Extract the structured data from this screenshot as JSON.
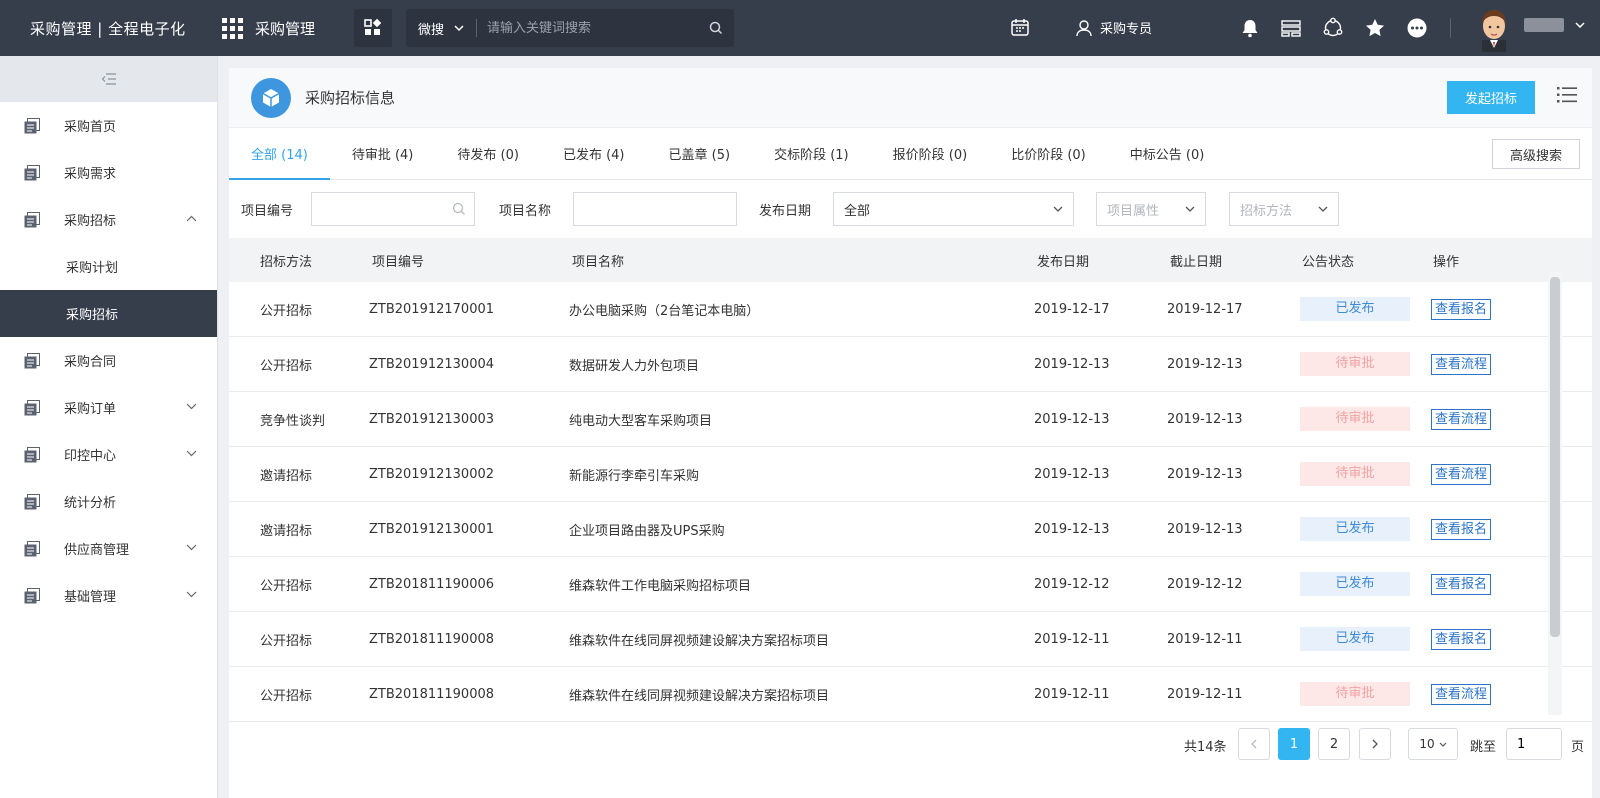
{
  "topbar": {
    "brand": "采购管理 | 全程电子化",
    "app_name": "采购管理",
    "search_type": "微搜",
    "search_placeholder": "请输入关键词搜索",
    "user_role": "采购专员"
  },
  "sidebar": {
    "items": [
      {
        "label": "采购首页"
      },
      {
        "label": "采购需求"
      },
      {
        "label": "采购招标"
      },
      {
        "label": "采购计划"
      },
      {
        "label": "采购招标"
      },
      {
        "label": "采购合同"
      },
      {
        "label": "采购订单"
      },
      {
        "label": "印控中心"
      },
      {
        "label": "统计分析"
      },
      {
        "label": "供应商管理"
      },
      {
        "label": "基础管理"
      }
    ]
  },
  "page": {
    "title": "采购招标信息",
    "primary_button": "发起招标",
    "advanced_search": "高级搜索"
  },
  "tabs": [
    {
      "label": "全部 (14)"
    },
    {
      "label": "待审批 (4)"
    },
    {
      "label": "待发布 (0)"
    },
    {
      "label": "已发布 (4)"
    },
    {
      "label": "已盖章 (5)"
    },
    {
      "label": "交标阶段 (1)"
    },
    {
      "label": "报价阶段 (0)"
    },
    {
      "label": "比价阶段 (0)"
    },
    {
      "label": "中标公告 (0)"
    }
  ],
  "filters": {
    "project_no_label": "项目编号",
    "project_name_label": "项目名称",
    "publish_date_label": "发布日期",
    "publish_date_value": "全部",
    "project_attr_placeholder": "项目属性",
    "bid_method_placeholder": "招标方法"
  },
  "table": {
    "headers": [
      "招标方法",
      "项目编号",
      "项目名称",
      "发布日期",
      "截止日期",
      "公告状态",
      "操作"
    ],
    "rows": [
      {
        "method": "公开招标",
        "no": "ZTB201912170001",
        "name": "办公电脑采购（2台笔记本电脑）",
        "publish": "2019-12-17",
        "deadline": "2019-12-17",
        "status": "已发布",
        "action": "查看报名"
      },
      {
        "method": "公开招标",
        "no": "ZTB201912130004",
        "name": "数据研发人力外包项目",
        "publish": "2019-12-13",
        "deadline": "2019-12-13",
        "status": "待审批",
        "action": "查看流程"
      },
      {
        "method": "竞争性谈判",
        "no": "ZTB201912130003",
        "name": "纯电动大型客车采购项目",
        "publish": "2019-12-13",
        "deadline": "2019-12-13",
        "status": "待审批",
        "action": "查看流程"
      },
      {
        "method": "邀请招标",
        "no": "ZTB201912130002",
        "name": "新能源行李牵引车采购",
        "publish": "2019-12-13",
        "deadline": "2019-12-13",
        "status": "待审批",
        "action": "查看流程"
      },
      {
        "method": "邀请招标",
        "no": "ZTB201912130001",
        "name": "企业项目路由器及UPS采购",
        "publish": "2019-12-13",
        "deadline": "2019-12-13",
        "status": "已发布",
        "action": "查看报名"
      },
      {
        "method": "公开招标",
        "no": "ZTB201811190006",
        "name": "维森软件工作电脑采购招标项目",
        "publish": "2019-12-12",
        "deadline": "2019-12-12",
        "status": "已发布",
        "action": "查看报名"
      },
      {
        "method": "公开招标",
        "no": "ZTB201811190008",
        "name": "维森软件在线同屏视频建设解决方案招标项目",
        "publish": "2019-12-11",
        "deadline": "2019-12-11",
        "status": "已发布",
        "action": "查看报名"
      },
      {
        "method": "公开招标",
        "no": "ZTB201811190008",
        "name": "维森软件在线同屏视频建设解决方案招标项目",
        "publish": "2019-12-11",
        "deadline": "2019-12-11",
        "status": "待审批",
        "action": "查看流程"
      }
    ]
  },
  "pagination": {
    "total": "共14条",
    "pages": [
      "1",
      "2"
    ],
    "page_size": "10",
    "jump_label": "跳至",
    "jump_value": "1",
    "page_unit": "页"
  },
  "colors": {
    "topbar": "#363e4c",
    "accent": "#33b5f2",
    "published_text": "#3f8ad6",
    "pending_text": "#f0a3a3"
  }
}
